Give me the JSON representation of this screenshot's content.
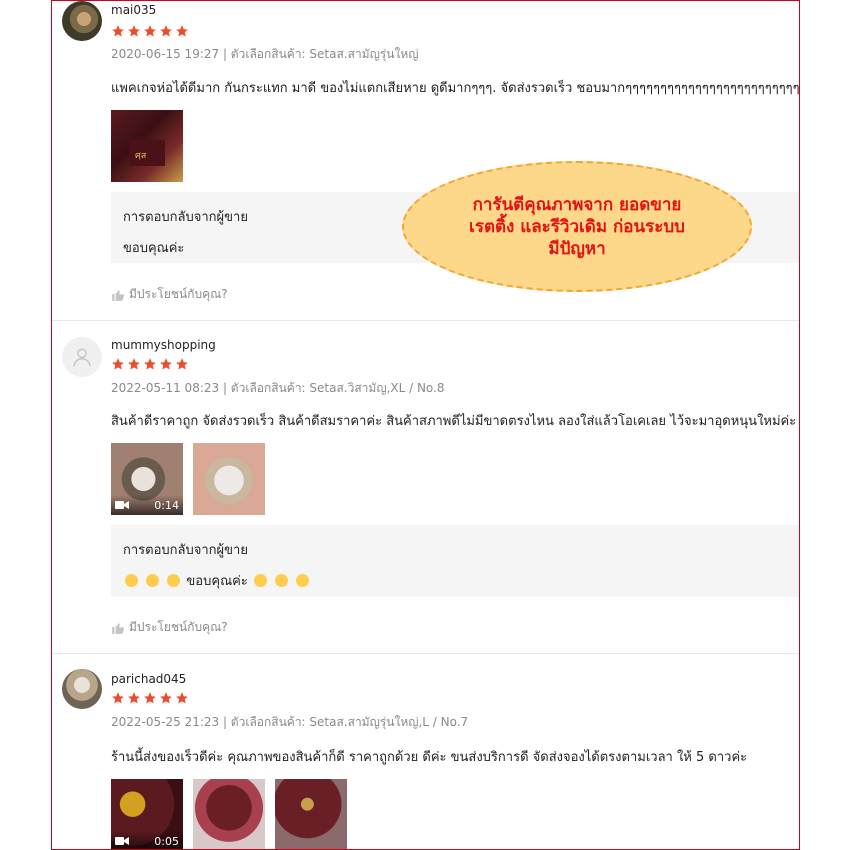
{
  "reviews": [
    {
      "username": "mai035",
      "rating": 5,
      "meta": "2020-06-15 19:27 | ตัวเลือกสินค้า: Setaส.สามัญรุ่นใหญ่",
      "content": "แพคเกจห่อได้ดีมาก กันกระแทก มาดี ของไม่แตกเสียหาย  ดูดีมากๆๆๆ. จัดส่งรวดเร็ว ชอบมากๆๆๆๆๆๆๆๆๆๆๆๆๆๆๆๆๆๆๆๆๆๆๆๆๆๆๆ",
      "reply_title": "การตอบกลับจากผู้ขาย",
      "reply_text": "ขอบคุณค่ะ",
      "helpful": "มีประโยชน์กับคุณ?"
    },
    {
      "username": "mummyshopping",
      "rating": 5,
      "meta": "2022-05-11 08:23 | ตัวเลือกสินค้า: Setaส.วิสามัญ,XL / No.8",
      "content": "สินค้าดีราคาถูก จัดส่งรวดเร็ว สินค้าดีสมราคาค่ะ สินค้าสภาพดีไม่มีขาดตรงไหน ลองใส่แล้วโอเคเลย ไว้จะมาอุดหนุนใหม่ค่ะ",
      "video_duration": "0:14",
      "reply_title": "การตอบกลับจากผู้ขาย",
      "reply_text": "ขอบคุณค่ะ",
      "helpful": "มีประโยชน์กับคุณ?"
    },
    {
      "username": "parichad045",
      "rating": 5,
      "meta": "2022-05-25 21:23 | ตัวเลือกสินค้า: Setaส.สามัญรุ่นใหญ่,L / No.7",
      "content": "ร้านนี้ส่งของเร็วดีค่ะ คุณภาพของสินค้าก็ดี ราคาถูกด้วย ดีค่ะ ขนส่งบริการดี จัดส่งจองได้ตรงตามเวลา ให้ 5 ดาวค่ะ",
      "video_duration": "0:05"
    }
  ],
  "callout": {
    "line1": "การันตีคุณภาพจาก ยอดขาย",
    "line2": "เรตติ้ง และรีวิวเดิม ก่อนระบบ",
    "line3": "มีปัญหา"
  },
  "colors": {
    "star": "#ee4d2d",
    "frame": "#d0021b",
    "callout_text": "#e31313",
    "callout_fill": "#fdd78a"
  }
}
